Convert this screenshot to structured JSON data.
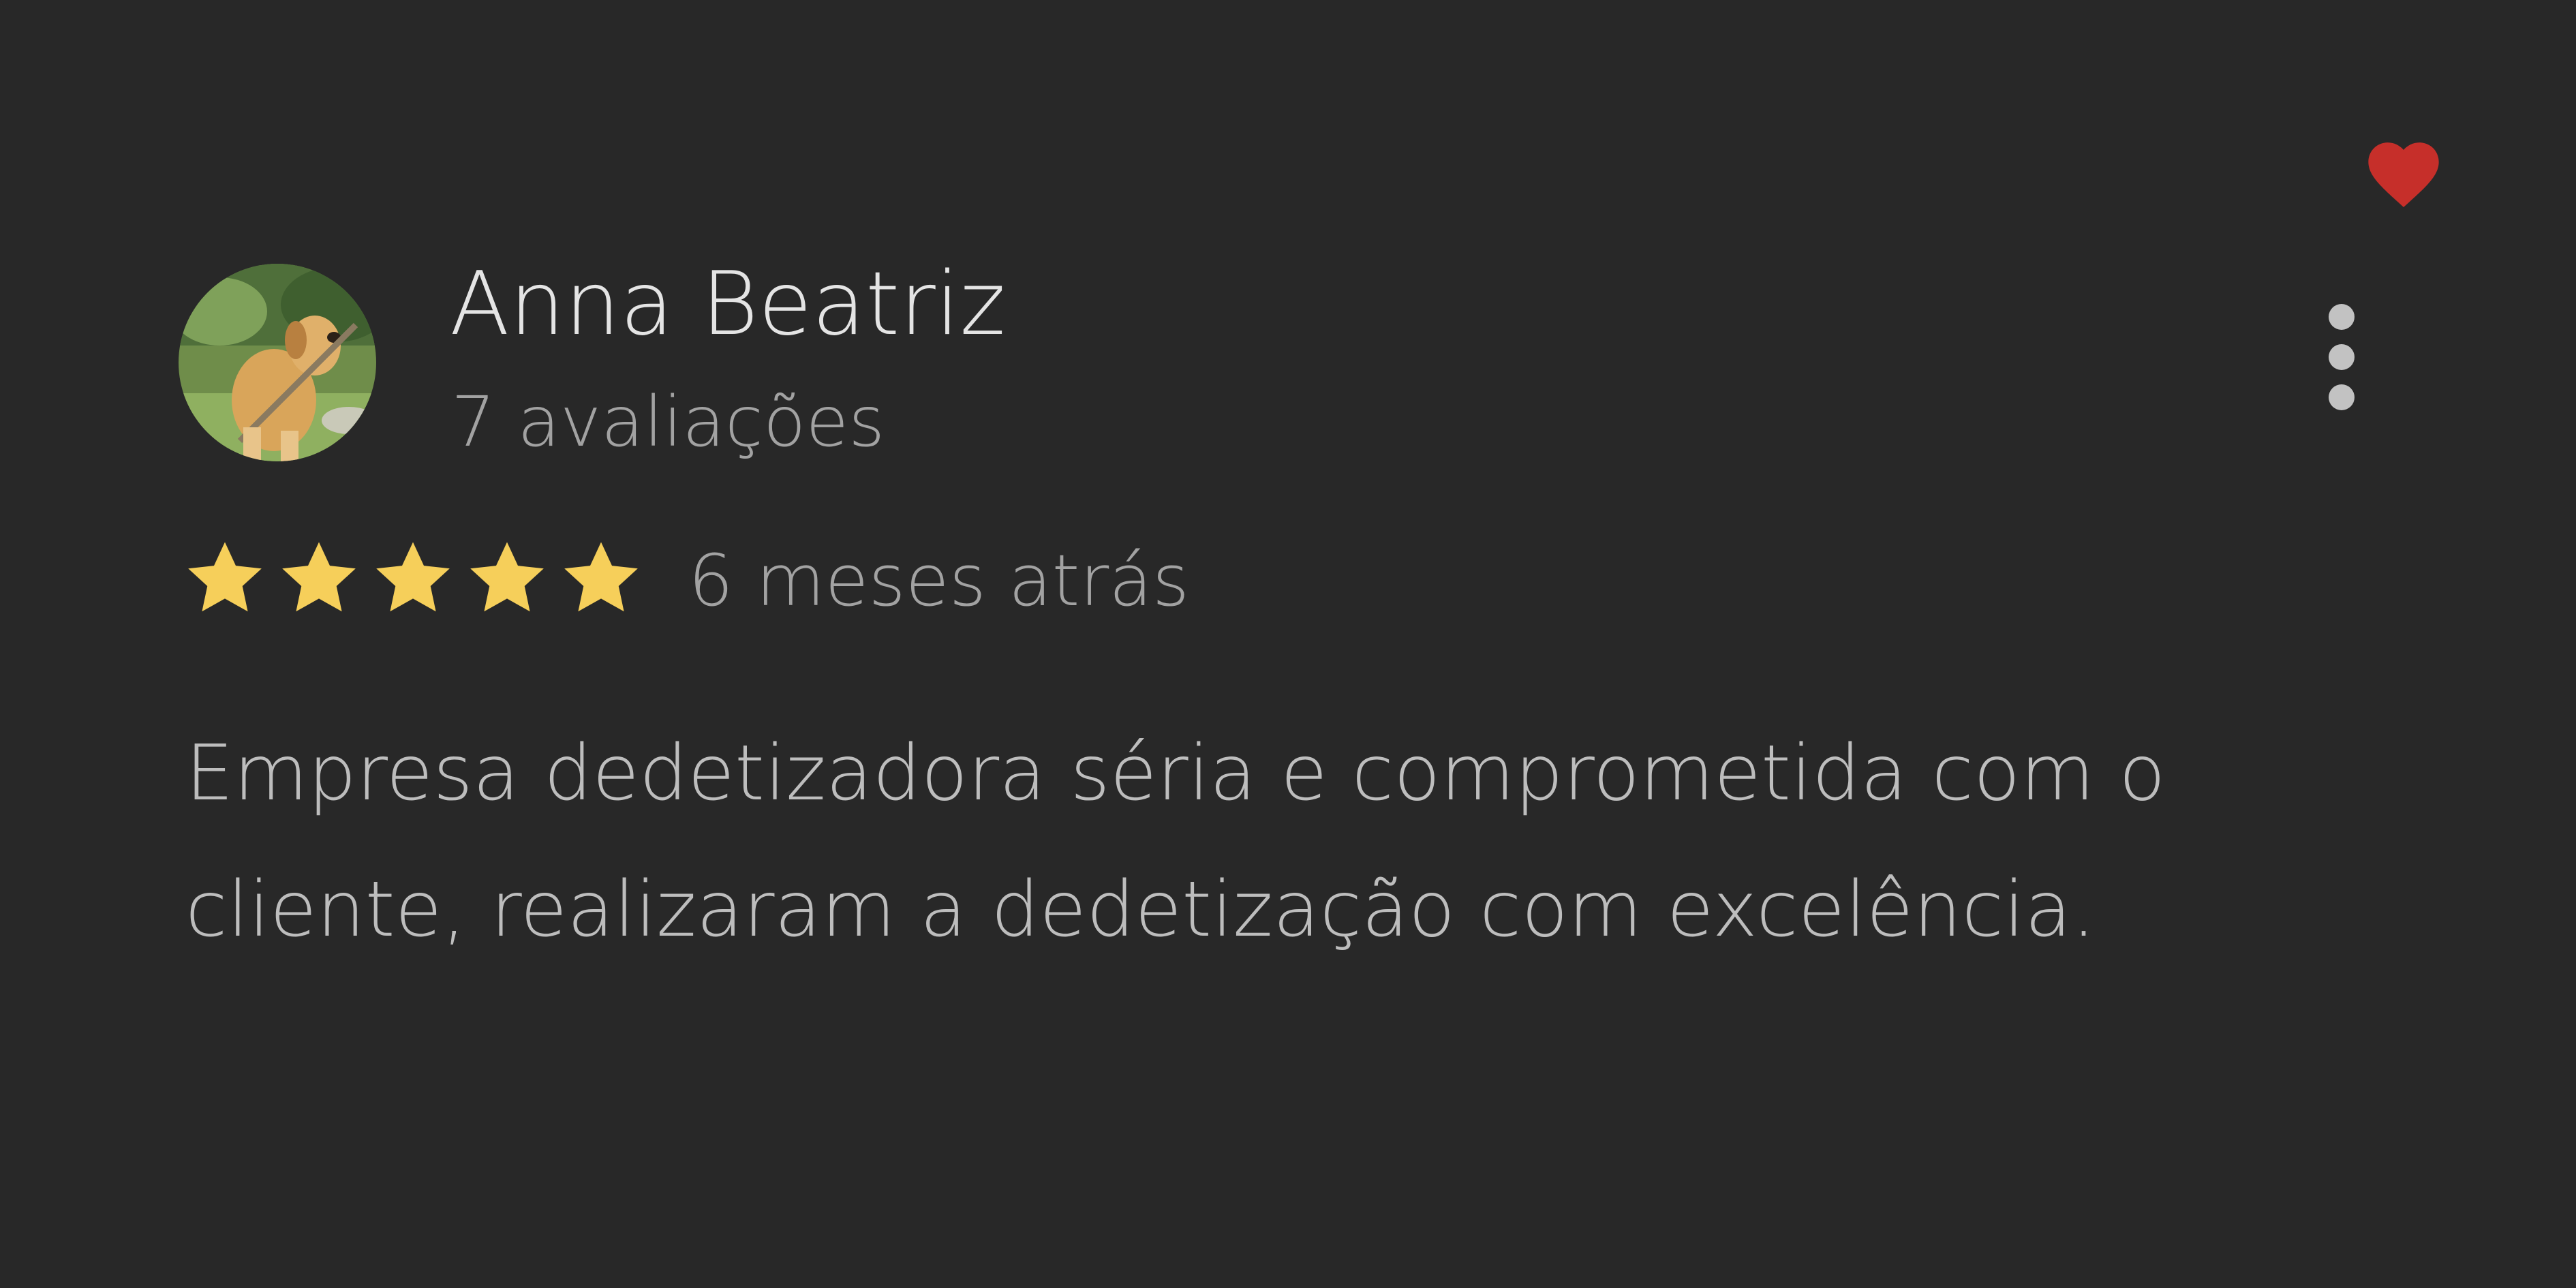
{
  "review": {
    "reviewer_name": "Anna Beatriz",
    "review_count": "7 avaliações",
    "rating": 5,
    "rating_max": 5,
    "time_ago": "6 meses atrás",
    "text": "Empresa dedetizadora séria e comprometida com o cliente, realizaram a dedetização com excelência."
  },
  "icons": {
    "favorite": "heart-icon",
    "more": "more-vert-icon",
    "star": "star-icon"
  },
  "colors": {
    "background": "#282828",
    "heart": "#c62f2a",
    "star": "#f6cf5a",
    "name": "#e4e4e4",
    "secondary_text": "#a2a2a2",
    "body_text": "#bdbdbd"
  }
}
